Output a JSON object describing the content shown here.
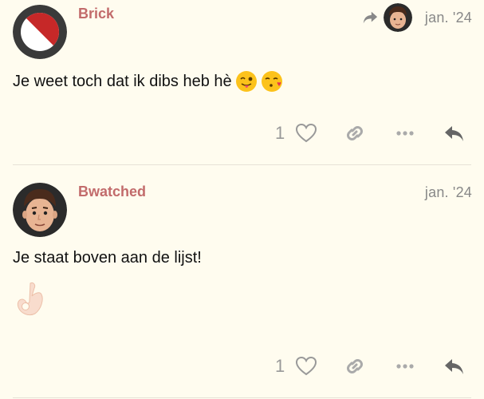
{
  "accent_color": "#c26b6b",
  "posts": [
    {
      "username": "Brick",
      "date": "jan. '24",
      "text": "Je weet toch dat ik dibs heb hè",
      "emojis": [
        "winking-face-with-tongue",
        "face-blowing-a-kiss"
      ],
      "like_count": "1",
      "reply_to_indicator": true,
      "icons": [
        "heart-icon",
        "link-icon",
        "more-icon",
        "reply-icon"
      ]
    },
    {
      "username": "Bwatched",
      "date": "jan. '24",
      "text": "Je staat boven aan de lijst!",
      "emojis": [
        "ok-hand"
      ],
      "like_count": "1",
      "icons": [
        "heart-icon",
        "link-icon",
        "more-icon",
        "reply-icon"
      ]
    }
  ]
}
